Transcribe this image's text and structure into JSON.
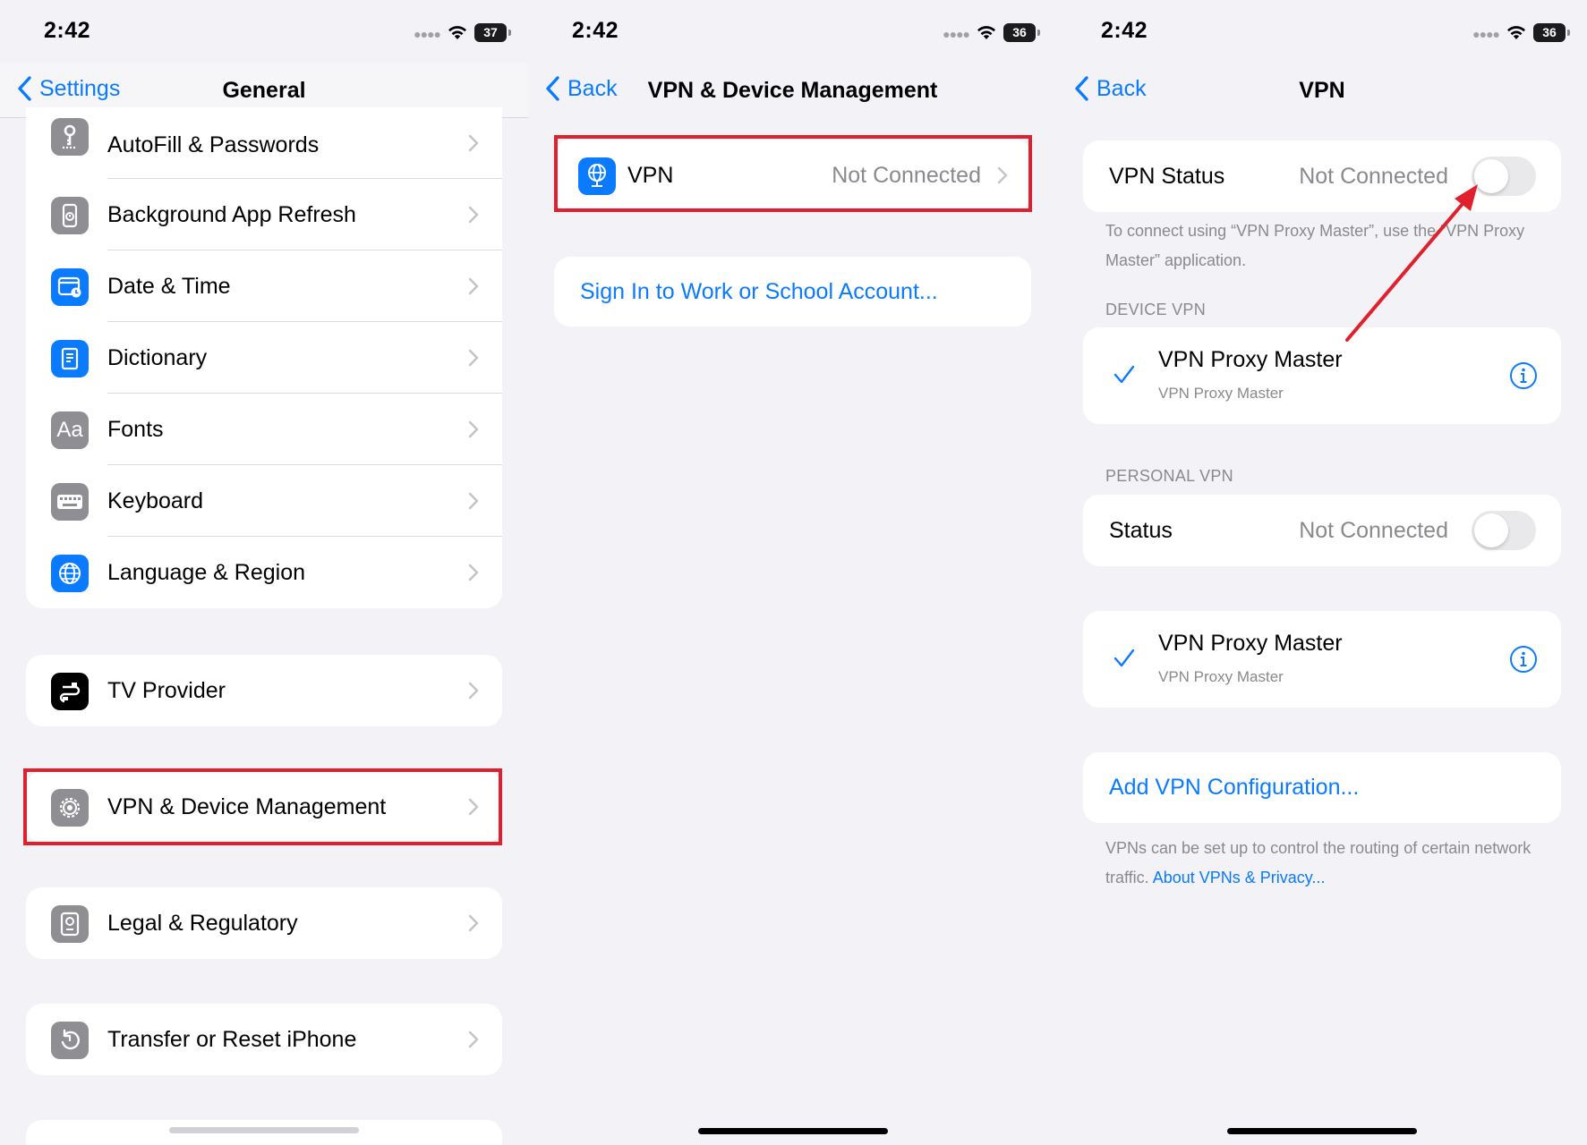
{
  "panels": [
    {
      "time": "2:42",
      "battery": "37",
      "back_label": "Settings",
      "title": "General",
      "groups": [
        [
          {
            "label": "AutoFill & Passwords",
            "icon": "key-icon",
            "color": "#8e8e93"
          },
          {
            "label": "Background App Refresh",
            "icon": "refresh-timer-icon",
            "color": "#8e8e93"
          },
          {
            "label": "Date & Time",
            "icon": "calendar-clock-icon",
            "color": "#0a7aff"
          },
          {
            "label": "Dictionary",
            "icon": "book-icon",
            "color": "#0a7aff"
          },
          {
            "label": "Fonts",
            "icon": "fonts-icon",
            "glyph": "Aa",
            "color": "#8e8e93"
          },
          {
            "label": "Keyboard",
            "icon": "keyboard-icon",
            "color": "#8e8e93"
          },
          {
            "label": "Language & Region",
            "icon": "globe-icon",
            "color": "#0a7aff"
          }
        ],
        [
          {
            "label": "TV Provider",
            "icon": "tv-provider-icon",
            "color": "#000000"
          }
        ],
        [
          {
            "label": "VPN & Device Management",
            "icon": "gear-icon",
            "color": "#8e8e93"
          }
        ],
        [
          {
            "label": "Legal & Regulatory",
            "icon": "legal-badge-icon",
            "color": "#8e8e93"
          }
        ],
        [
          {
            "label": "Transfer or Reset iPhone",
            "icon": "reset-icon",
            "color": "#8e8e93"
          }
        ]
      ]
    },
    {
      "time": "2:42",
      "battery": "36",
      "back_label": "Back",
      "title": "VPN & Device Management",
      "vpn_row": {
        "label": "VPN",
        "value": "Not Connected",
        "icon": "vpn-globe-icon"
      },
      "sign_in_link": "Sign In to Work or School Account..."
    },
    {
      "time": "2:42",
      "battery": "36",
      "back_label": "Back",
      "title": "VPN",
      "vpn_status": {
        "label": "VPN Status",
        "value": "Not Connected",
        "toggle_on": false
      },
      "vpn_status_caption": "To connect using “VPN Proxy Master”, use the “VPN Proxy Master” application.",
      "device_vpn_header": "DEVICE VPN",
      "device_vpn": {
        "name": "VPN Proxy Master",
        "subtitle": "VPN Proxy Master"
      },
      "personal_vpn_header": "PERSONAL VPN",
      "personal_status": {
        "label": "Status",
        "value": "Not Connected",
        "toggle_on": false
      },
      "personal_vpn": {
        "name": "VPN Proxy Master",
        "subtitle": "VPN Proxy Master"
      },
      "add_config": "Add VPN Configuration...",
      "footer_text": "VPNs can be set up to control the routing of certain network traffic.",
      "footer_link": "About VPNs & Privacy..."
    }
  ],
  "colors": {
    "accent": "#0a7aff",
    "highlight": "#e0202c",
    "background": "#f2f2f7"
  }
}
